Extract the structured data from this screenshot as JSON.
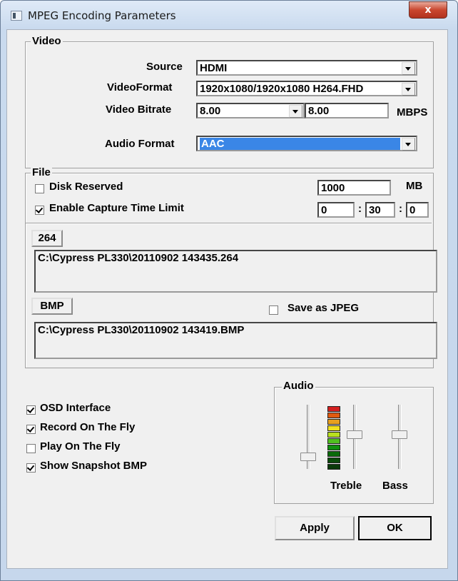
{
  "window": {
    "title": "MPEG Encoding Parameters",
    "close_glyph": "x"
  },
  "video": {
    "group_label": "Video",
    "source_label": "Source",
    "source_value": "HDMI",
    "videoformat_label": "VideoFormat",
    "videoformat_value": "1920x1080/1920x1080 H264.FHD",
    "bitrate_label": "Video Bitrate",
    "bitrate_value": "8.00",
    "bitrate_value2": "8.00",
    "bitrate_unit": "MBPS",
    "audioformat_label": "Audio Format",
    "audioformat_value": "AAC"
  },
  "file": {
    "group_label": "File",
    "disk_reserved_label": "Disk Reserved",
    "disk_reserved_checked": false,
    "disk_reserved_value": "1000",
    "disk_reserved_unit": "MB",
    "capture_limit_label": "Enable Capture Time Limit",
    "capture_limit_checked": true,
    "time_h": "0",
    "time_m": "30",
    "time_s": "0",
    "time_sep": ":",
    "btn_264": "264",
    "path_264": "C:\\Cypress PL330\\20110902 143435.264",
    "btn_bmp": "BMP",
    "save_jpeg_label": "Save as JPEG",
    "save_jpeg_checked": false,
    "path_bmp": "C:\\Cypress PL330\\20110902 143419.BMP"
  },
  "options": [
    {
      "label": "OSD Interface",
      "checked": true
    },
    {
      "label": "Record On The Fly",
      "checked": true
    },
    {
      "label": "Play On The Fly",
      "checked": false
    },
    {
      "label": "Show Snapshot BMP",
      "checked": true
    }
  ],
  "audio": {
    "group_label": "Audio",
    "treble_label": "Treble",
    "bass_label": "Bass",
    "meter_colors": [
      "#d42020",
      "#e05a10",
      "#e8a020",
      "#f0e020",
      "#b8e020",
      "#50c020",
      "#109010",
      "#0a6a0a",
      "#0a4a0a",
      "#0a3a0a"
    ]
  },
  "buttons": {
    "apply": "Apply",
    "ok": "OK"
  }
}
